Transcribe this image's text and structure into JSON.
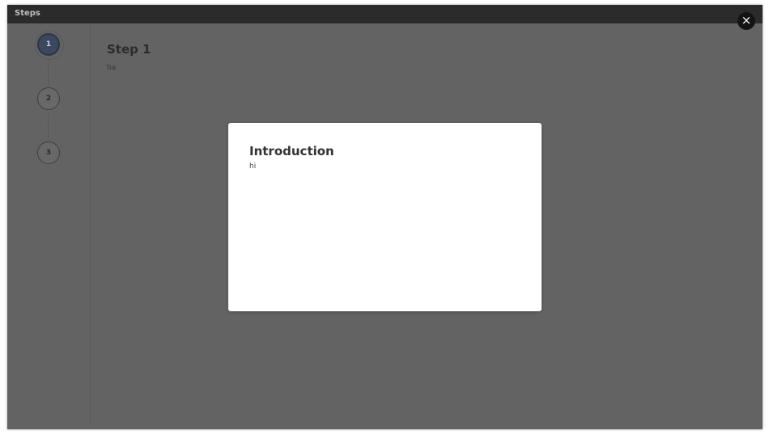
{
  "window": {
    "title": "Steps",
    "close_label": "×"
  },
  "steps": {
    "items": [
      {
        "number": "1",
        "active": true
      },
      {
        "number": "2",
        "active": false
      },
      {
        "number": "3",
        "active": false
      }
    ]
  },
  "content": {
    "title": "Step 1",
    "text": "ba"
  },
  "modal": {
    "title": "Introduction",
    "body": "hi"
  },
  "colors": {
    "overlay": "#636363",
    "titlebar": "#2b2b2b",
    "active_step": "#3a4860",
    "modal_bg": "#ffffff"
  }
}
